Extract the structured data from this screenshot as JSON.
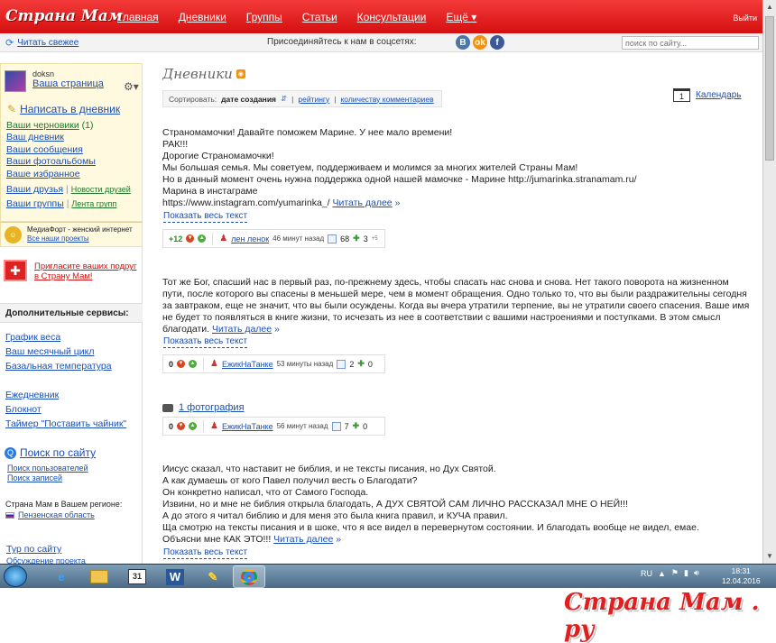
{
  "site": {
    "logo": "Страна Мам",
    "nav": [
      "Главная",
      "Дневники",
      "Группы",
      "Статьи",
      "Консультации",
      "Ещё"
    ],
    "exit": "Выйти",
    "accent": "#e3161b"
  },
  "subbar": {
    "fresh": "Читать свежее",
    "social_label": "Присоединяйтесь к нам в соцсетях:",
    "social_icons": [
      "vk-icon",
      "odnoklassniki-icon",
      "facebook-icon"
    ],
    "search_placeholder": "поиск по сайту..."
  },
  "sidebar": {
    "username": "doksn",
    "your_page": "Ваша страница",
    "write": "Написать в дневник",
    "drafts": "Ваши черновики",
    "drafts_count": "(1)",
    "diary": "Ваш дневник",
    "messages": "Ваши сообщения",
    "albums": "Ваши фотоальбомы",
    "favorites": "Ваше избранное",
    "friends": "Ваши друзья",
    "friends_news": "Новости друзей",
    "groups": "Ваши группы",
    "groups_feed": "Лента групп",
    "mediafort_text": "МедиаФорт - женский интернет",
    "all_projects": "Все наши проекты",
    "invite": "Пригласите ваших подруг в Страну Мам!",
    "extra_title": "Дополнительные сервисы:",
    "weight": "График веса",
    "cycle": "Ваш месячный цикл",
    "temperature": "Базальная температура",
    "planner": "Ежедневник",
    "notepad": "Блокнот",
    "kettle_timer": "Таймер \"Поставить чайник\"",
    "search_main": "Поиск по сайту",
    "search_users": "Поиск пользователей",
    "search_posts": "Поиск записей",
    "region_label": "Страна Мам в Вашем регионе:",
    "region": "Пензенская область",
    "tour": "Тур по сайту",
    "tour_sub": "Обсуждение проекта"
  },
  "main": {
    "title": "Дневники",
    "sort_label": "Сортировать:",
    "sort_by_date": "дате создания",
    "sort_by_rating": "рейтингу",
    "sort_by_comments": "количеству комментариев",
    "calendar": "Календарь",
    "read_more": "Читать далее",
    "show_all": "Показать весь текст",
    "posts": [
      {
        "lines": [
          "Страномамочки! Давайте поможем Марине. У нее мало времени!",
          "РАК!!!",
          "Дорогие Страномамочки!",
          "Мы большая семья. Мы советуем, поддерживаем и молимся за многих жителей Страны Мам!",
          "Но в данный момент очень нужна поддержка одной нашей мамочке - Марине http://jumarinka.stranamam.ru/",
          "Марина в инстаграме",
          "https://www.instagram.com/yumarinka_/"
        ],
        "rating": "+12",
        "author": "лен ленок",
        "time_ago": "46 минут назад",
        "comments": "68",
        "plus": "3",
        "plus_sup": "+5"
      },
      {
        "lines": [
          "Тот же Бог, спасший нас в первый раз, по-прежнему здесь, чтобы спасать нас снова и снова. Нет такого поворота на жизненном",
          "пути, после которого вы спасены в меньшей мере, чем в момент обращения. Одно только то, что вы были раздражительны сегодня",
          "за завтраком, еще не значит, что вы были осуждены. Когда вы вчера утратили терпение, вы не утратили своего спасения. Ваше имя",
          "не будет то появляться в книге жизни, то исчезать из нее в соответствии с вашими настроениями и поступками. В этом смысл",
          "благодати."
        ],
        "rating": "0",
        "author": "ЕжикНаТанке",
        "time_ago": "53 минуты назад",
        "comments": "2",
        "plus": "0"
      },
      {
        "photo_link": "1 фотография",
        "rating": "0",
        "author": "ЕжикНаТанке",
        "time_ago": "56 минут назад",
        "comments": "7",
        "plus": "0"
      },
      {
        "lines": [
          "Иисус сказал, что наставит не библия, и не тексты писания, но Дух Святой.",
          "А как думаешь от кого Павел получил весть о Благодати?",
          "Он конкретно написал, что от Самого Господа.",
          "Извини, но и мне не библия открыла благодать, А ДУХ СВЯТОЙ САМ ЛИЧНО РАССКАЗАЛ МНЕ О НЕЙ!!!",
          "А до этого я читал библию и для меня это была книга правил, и КУЧА правил.",
          "Ща смотрю на тексты писания и в шоке, что я все видел в перевернутом состоянии. И благодать вообще не видел, емае.",
          "Объясни мне КАК ЭТО!!!"
        ]
      }
    ]
  },
  "taskbar": {
    "lang": "RU",
    "time": "18:31",
    "date": "12.04.2016",
    "apps": [
      "ie-icon",
      "explorer-icon",
      "calendar-icon",
      "word-icon",
      "tool-icon",
      "chrome-icon"
    ]
  },
  "watermark": "Страна Мам . ру"
}
